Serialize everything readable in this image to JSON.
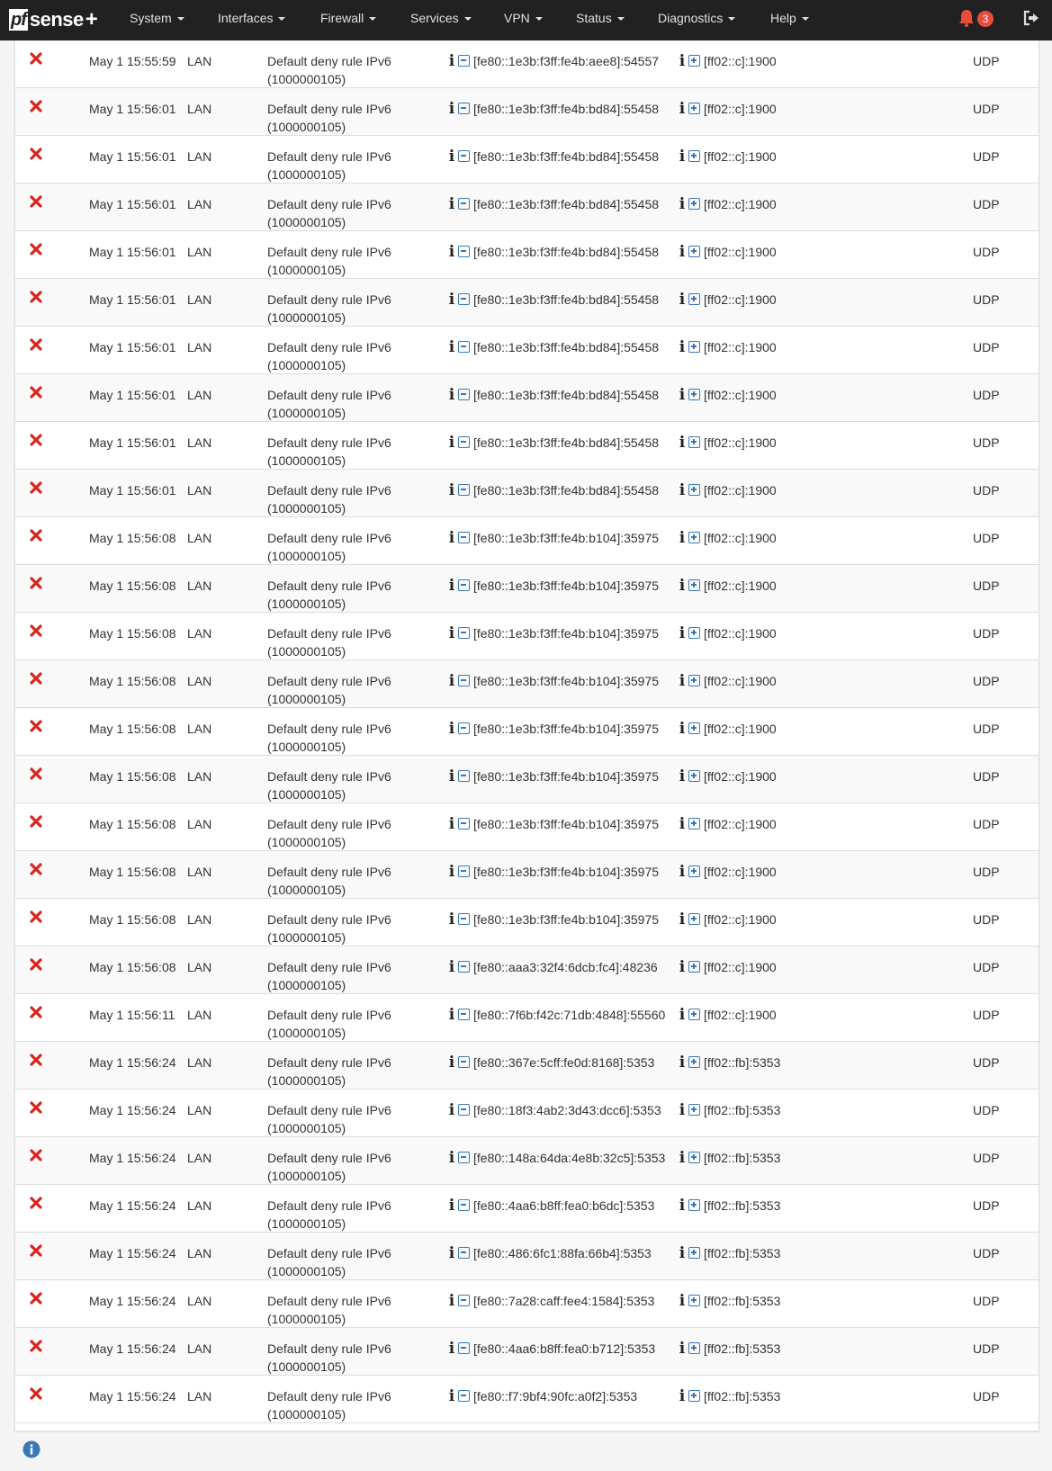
{
  "navbar": {
    "brand": {
      "pf": "pf",
      "sense": "sense",
      "plus": "+"
    },
    "menu": [
      "System",
      "Interfaces",
      "Firewall",
      "Services",
      "VPN",
      "Status",
      "Diagnostics",
      "Help"
    ],
    "notification_count": "3"
  },
  "colors": {
    "navbar": "#212121",
    "accent_red": "#d9241c",
    "link_blue": "#3a78b5",
    "badge_red": "#e84c3d"
  },
  "icons": {
    "action": "close-x-icon",
    "info": "info-icon",
    "block": "minus-square-icon",
    "pass": "plus-square-icon",
    "alert": "bell-icon",
    "logout": "sign-out-icon",
    "footer": "info-circle-icon"
  },
  "log_rows": [
    {
      "time": "May 1 15:55:59",
      "iface": "LAN",
      "rule": "Default deny rule IPv6 (1000000105)",
      "src": "[fe80::1e3b:f3ff:fe4b:aee8]:54557",
      "dst": "[ff02::c]:1900",
      "proto": "UDP"
    },
    {
      "time": "May 1 15:56:01",
      "iface": "LAN",
      "rule": "Default deny rule IPv6 (1000000105)",
      "src": "[fe80::1e3b:f3ff:fe4b:bd84]:55458",
      "dst": "[ff02::c]:1900",
      "proto": "UDP"
    },
    {
      "time": "May 1 15:56:01",
      "iface": "LAN",
      "rule": "Default deny rule IPv6 (1000000105)",
      "src": "[fe80::1e3b:f3ff:fe4b:bd84]:55458",
      "dst": "[ff02::c]:1900",
      "proto": "UDP"
    },
    {
      "time": "May 1 15:56:01",
      "iface": "LAN",
      "rule": "Default deny rule IPv6 (1000000105)",
      "src": "[fe80::1e3b:f3ff:fe4b:bd84]:55458",
      "dst": "[ff02::c]:1900",
      "proto": "UDP"
    },
    {
      "time": "May 1 15:56:01",
      "iface": "LAN",
      "rule": "Default deny rule IPv6 (1000000105)",
      "src": "[fe80::1e3b:f3ff:fe4b:bd84]:55458",
      "dst": "[ff02::c]:1900",
      "proto": "UDP"
    },
    {
      "time": "May 1 15:56:01",
      "iface": "LAN",
      "rule": "Default deny rule IPv6 (1000000105)",
      "src": "[fe80::1e3b:f3ff:fe4b:bd84]:55458",
      "dst": "[ff02::c]:1900",
      "proto": "UDP"
    },
    {
      "time": "May 1 15:56:01",
      "iface": "LAN",
      "rule": "Default deny rule IPv6 (1000000105)",
      "src": "[fe80::1e3b:f3ff:fe4b:bd84]:55458",
      "dst": "[ff02::c]:1900",
      "proto": "UDP"
    },
    {
      "time": "May 1 15:56:01",
      "iface": "LAN",
      "rule": "Default deny rule IPv6 (1000000105)",
      "src": "[fe80::1e3b:f3ff:fe4b:bd84]:55458",
      "dst": "[ff02::c]:1900",
      "proto": "UDP"
    },
    {
      "time": "May 1 15:56:01",
      "iface": "LAN",
      "rule": "Default deny rule IPv6 (1000000105)",
      "src": "[fe80::1e3b:f3ff:fe4b:bd84]:55458",
      "dst": "[ff02::c]:1900",
      "proto": "UDP"
    },
    {
      "time": "May 1 15:56:01",
      "iface": "LAN",
      "rule": "Default deny rule IPv6 (1000000105)",
      "src": "[fe80::1e3b:f3ff:fe4b:bd84]:55458",
      "dst": "[ff02::c]:1900",
      "proto": "UDP"
    },
    {
      "time": "May 1 15:56:08",
      "iface": "LAN",
      "rule": "Default deny rule IPv6 (1000000105)",
      "src": "[fe80::1e3b:f3ff:fe4b:b104]:35975",
      "dst": "[ff02::c]:1900",
      "proto": "UDP"
    },
    {
      "time": "May 1 15:56:08",
      "iface": "LAN",
      "rule": "Default deny rule IPv6 (1000000105)",
      "src": "[fe80::1e3b:f3ff:fe4b:b104]:35975",
      "dst": "[ff02::c]:1900",
      "proto": "UDP"
    },
    {
      "time": "May 1 15:56:08",
      "iface": "LAN",
      "rule": "Default deny rule IPv6 (1000000105)",
      "src": "[fe80::1e3b:f3ff:fe4b:b104]:35975",
      "dst": "[ff02::c]:1900",
      "proto": "UDP"
    },
    {
      "time": "May 1 15:56:08",
      "iface": "LAN",
      "rule": "Default deny rule IPv6 (1000000105)",
      "src": "[fe80::1e3b:f3ff:fe4b:b104]:35975",
      "dst": "[ff02::c]:1900",
      "proto": "UDP"
    },
    {
      "time": "May 1 15:56:08",
      "iface": "LAN",
      "rule": "Default deny rule IPv6 (1000000105)",
      "src": "[fe80::1e3b:f3ff:fe4b:b104]:35975",
      "dst": "[ff02::c]:1900",
      "proto": "UDP"
    },
    {
      "time": "May 1 15:56:08",
      "iface": "LAN",
      "rule": "Default deny rule IPv6 (1000000105)",
      "src": "[fe80::1e3b:f3ff:fe4b:b104]:35975",
      "dst": "[ff02::c]:1900",
      "proto": "UDP"
    },
    {
      "time": "May 1 15:56:08",
      "iface": "LAN",
      "rule": "Default deny rule IPv6 (1000000105)",
      "src": "[fe80::1e3b:f3ff:fe4b:b104]:35975",
      "dst": "[ff02::c]:1900",
      "proto": "UDP"
    },
    {
      "time": "May 1 15:56:08",
      "iface": "LAN",
      "rule": "Default deny rule IPv6 (1000000105)",
      "src": "[fe80::1e3b:f3ff:fe4b:b104]:35975",
      "dst": "[ff02::c]:1900",
      "proto": "UDP"
    },
    {
      "time": "May 1 15:56:08",
      "iface": "LAN",
      "rule": "Default deny rule IPv6 (1000000105)",
      "src": "[fe80::1e3b:f3ff:fe4b:b104]:35975",
      "dst": "[ff02::c]:1900",
      "proto": "UDP"
    },
    {
      "time": "May 1 15:56:08",
      "iface": "LAN",
      "rule": "Default deny rule IPv6 (1000000105)",
      "src": "[fe80::aaa3:32f4:6dcb:fc4]:48236",
      "dst": "[ff02::c]:1900",
      "proto": "UDP"
    },
    {
      "time": "May 1 15:56:11",
      "iface": "LAN",
      "rule": "Default deny rule IPv6 (1000000105)",
      "src": "[fe80::7f6b:f42c:71db:4848]:55560",
      "dst": "[ff02::c]:1900",
      "proto": "UDP"
    },
    {
      "time": "May 1 15:56:24",
      "iface": "LAN",
      "rule": "Default deny rule IPv6 (1000000105)",
      "src": "[fe80::367e:5cff:fe0d:8168]:5353",
      "dst": "[ff02::fb]:5353",
      "proto": "UDP"
    },
    {
      "time": "May 1 15:56:24",
      "iface": "LAN",
      "rule": "Default deny rule IPv6 (1000000105)",
      "src": "[fe80::18f3:4ab2:3d43:dcc6]:5353",
      "dst": "[ff02::fb]:5353",
      "proto": "UDP"
    },
    {
      "time": "May 1 15:56:24",
      "iface": "LAN",
      "rule": "Default deny rule IPv6 (1000000105)",
      "src": "[fe80::148a:64da:4e8b:32c5]:5353",
      "dst": "[ff02::fb]:5353",
      "proto": "UDP"
    },
    {
      "time": "May 1 15:56:24",
      "iface": "LAN",
      "rule": "Default deny rule IPv6 (1000000105)",
      "src": "[fe80::4aa6:b8ff:fea0:b6dc]:5353",
      "dst": "[ff02::fb]:5353",
      "proto": "UDP"
    },
    {
      "time": "May 1 15:56:24",
      "iface": "LAN",
      "rule": "Default deny rule IPv6 (1000000105)",
      "src": "[fe80::486:6fc1:88fa:66b4]:5353",
      "dst": "[ff02::fb]:5353",
      "proto": "UDP"
    },
    {
      "time": "May 1 15:56:24",
      "iface": "LAN",
      "rule": "Default deny rule IPv6 (1000000105)",
      "src": "[fe80::7a28:caff:fee4:1584]:5353",
      "dst": "[ff02::fb]:5353",
      "proto": "UDP"
    },
    {
      "time": "May 1 15:56:24",
      "iface": "LAN",
      "rule": "Default deny rule IPv6 (1000000105)",
      "src": "[fe80::4aa6:b8ff:fea0:b712]:5353",
      "dst": "[ff02::fb]:5353",
      "proto": "UDP"
    },
    {
      "time": "May 1 15:56:24",
      "iface": "LAN",
      "rule": "Default deny rule IPv6 (1000000105)",
      "src": "[fe80::f7:9bf4:90fc:a0f2]:5353",
      "dst": "[ff02::fb]:5353",
      "proto": "UDP"
    }
  ]
}
